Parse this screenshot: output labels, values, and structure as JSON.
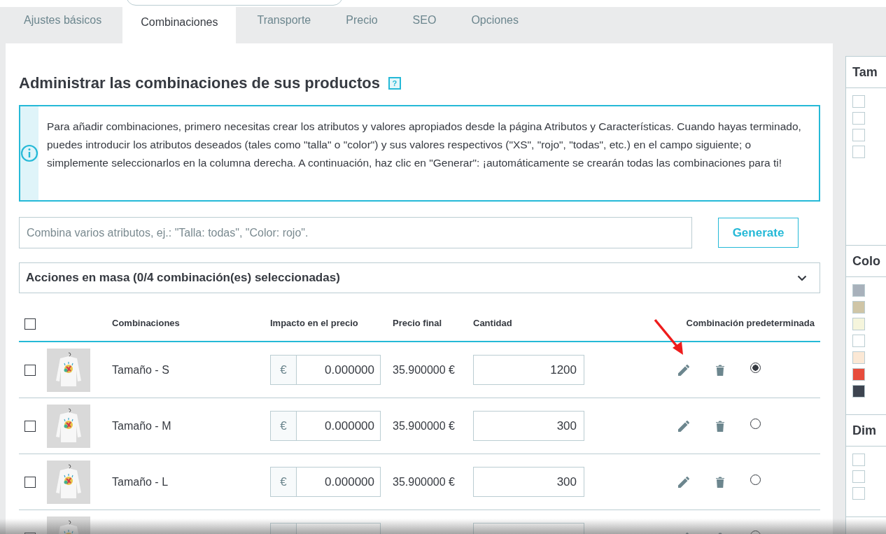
{
  "tabs": [
    {
      "label": "Ajustes básicos",
      "selected": false
    },
    {
      "label": "Combinaciones",
      "selected": true
    },
    {
      "label": "Transporte",
      "selected": false
    },
    {
      "label": "Precio",
      "selected": false
    },
    {
      "label": "SEO",
      "selected": false
    },
    {
      "label": "Opciones",
      "selected": false
    }
  ],
  "heading": "Administrar las combinaciones de sus productos",
  "help_badge": "?",
  "info": "Para añadir combinaciones, primero necesitas crear los atributos y valores apropiados desde la página Atributos y Características. Cuando hayas terminado, puedes introducir los atributos deseados (tales como \"talla\" o \"color\") y sus valores respectivos (\"XS\", \"rojo\", \"todas\", etc.) en el campo siguiente; o simplemente seleccionarlos en la columna derecha. A continuación, haz clic en \"Generar\": ¡automáticamente se crearán todas las combinaciones para ti!",
  "attribute_input": {
    "placeholder": "Combina varios atributos, ej.: \"Talla: todas\", \"Color: rojo\"."
  },
  "generate_button": "Generate",
  "bulk_actions": {
    "label": "Acciones en masa (0/4 combinación(es) seleccionadas)",
    "expanded": false
  },
  "table": {
    "select_all": false,
    "columns": [
      "Combinaciones",
      "Impacto en el precio",
      "Precio final",
      "Cantidad",
      "Combinación predeterminada"
    ],
    "rows": [
      {
        "checked": false,
        "name": "Tamaño - S",
        "currency": "€",
        "impact": "0.000000",
        "final_price": "35.900000 €",
        "quantity": "1200",
        "default": true
      },
      {
        "checked": false,
        "name": "Tamaño - M",
        "currency": "€",
        "impact": "0.000000",
        "final_price": "35.900000 €",
        "quantity": "300",
        "default": false
      },
      {
        "checked": false,
        "name": "Tamaño - L",
        "currency": "€",
        "impact": "0.000000",
        "final_price": "35.900000 €",
        "quantity": "300",
        "default": false
      },
      {
        "checked": false,
        "default": false
      }
    ]
  },
  "attribute_panel": [
    {
      "title": "Tam",
      "items": [
        {
          "kind": "checkbox",
          "checked": false
        },
        {
          "kind": "checkbox",
          "checked": false
        },
        {
          "kind": "checkbox",
          "checked": false
        },
        {
          "kind": "checkbox",
          "checked": false
        }
      ]
    },
    {
      "title": "Colo",
      "items": [
        {
          "kind": "swatch",
          "color": "#a8b1bb"
        },
        {
          "kind": "swatch",
          "color": "#cfc5a6"
        },
        {
          "kind": "swatch",
          "color": "#f5f5dc"
        },
        {
          "kind": "swatch",
          "color": "#ffffff"
        },
        {
          "kind": "swatch",
          "color": "#fbe8d5"
        },
        {
          "kind": "swatch",
          "color": "#e74c3c"
        },
        {
          "kind": "swatch",
          "color": "#3d4450"
        }
      ]
    },
    {
      "title": "Dim",
      "items": [
        {
          "kind": "checkbox",
          "checked": false
        },
        {
          "kind": "checkbox",
          "checked": false
        },
        {
          "kind": "checkbox",
          "checked": false
        }
      ]
    }
  ]
}
